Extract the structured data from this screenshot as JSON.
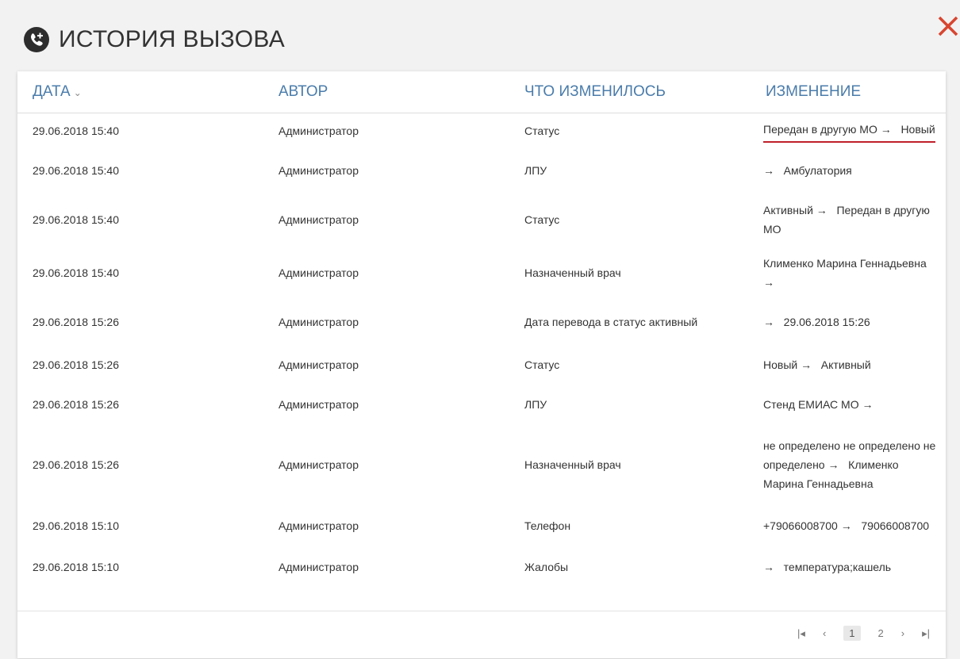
{
  "title": "ИСТОРИЯ ВЫЗОВА",
  "icon": "phone-add-icon",
  "close_icon": "close-icon",
  "accent": "#4a7cab",
  "close_color": "#d8452f",
  "columns": {
    "date": "ДАТА",
    "author": "АВТОР",
    "what": "ЧТО ИЗМЕНИЛОСЬ",
    "change": "ИЗМЕНЕНИЕ"
  },
  "rows": [
    {
      "date": "29.06.2018 15:40",
      "author": "Администратор",
      "what": "Статус",
      "from": "Передан в другую МО",
      "arrow": "→",
      "to": "Новый"
    },
    {
      "date": "29.06.2018 15:40",
      "author": "Администратор",
      "what": "ЛПУ",
      "from": "",
      "arrow": "→",
      "to": "Амбулатория"
    },
    {
      "date": "29.06.2018 15:40",
      "author": "Администратор",
      "what": "Статус",
      "from": "Активный",
      "arrow": "→",
      "to": "Передан в другую МО"
    },
    {
      "date": "29.06.2018 15:40",
      "author": "Администратор",
      "what": "Назначенный врач",
      "from": "Клименко Марина Геннадьевна",
      "arrow": "→",
      "to": ""
    },
    {
      "date": "29.06.2018 15:26",
      "author": "Администратор",
      "what": "Дата перевода в статус активный",
      "from": "",
      "arrow": "→",
      "to": "29.06.2018 15:26"
    },
    {
      "date": "29.06.2018 15:26",
      "author": "Администратор",
      "what": "Статус",
      "from": "Новый",
      "arrow": "→",
      "to": "Активный"
    },
    {
      "date": "29.06.2018 15:26",
      "author": "Администратор",
      "what": "ЛПУ",
      "from": "Стенд ЕМИАС МО",
      "arrow": "→",
      "to": ""
    },
    {
      "date": "29.06.2018 15:26",
      "author": "Администратор",
      "what": "Назначенный врач",
      "from": "не определено не определено не определено",
      "arrow": "→",
      "to": "Клименко Марина Геннадьевна"
    },
    {
      "date": "29.06.2018 15:10",
      "author": "Администратор",
      "what": "Телефон",
      "from": "+79066008700",
      "arrow": "→",
      "to": "79066008700"
    },
    {
      "date": "29.06.2018 15:10",
      "author": "Администратор",
      "what": "Жалобы",
      "from": "",
      "arrow": "→",
      "to": "температура;кашель"
    }
  ],
  "pager": {
    "first": "|◂",
    "prev": "‹",
    "pages": [
      "1",
      "2"
    ],
    "current": "1",
    "next": "›",
    "last": "▸|"
  }
}
